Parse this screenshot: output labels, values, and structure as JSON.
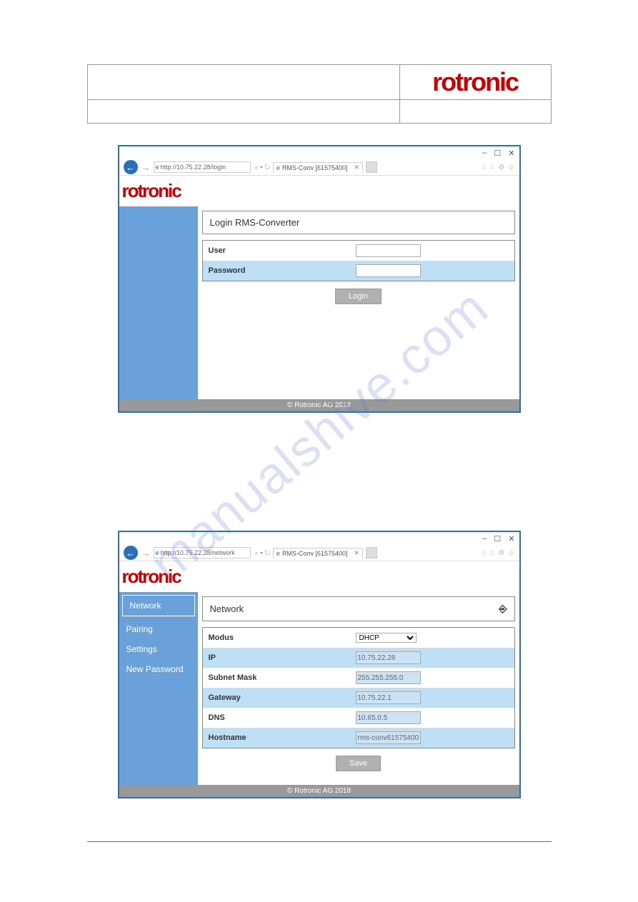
{
  "logo_text": "rotronic",
  "watermark": "manualshive.com",
  "screenshot1": {
    "win_controls": {
      "min": "–",
      "max": "☐",
      "close": "✕"
    },
    "url": "http://10.75.22.28/login",
    "search_icons": "⌕ ▾ ↻",
    "tab_label": "RMS-Conv [61575400]",
    "tab_close": "✕",
    "title_icons": {
      "home": "⌂",
      "star": "☆",
      "gear": "⚙",
      "smile": "☺"
    },
    "panel_title": "Login RMS-Converter",
    "rows": {
      "user": "User",
      "password": "Password"
    },
    "login_button": "Login",
    "footer": "© Rotronic AG 2018"
  },
  "screenshot2": {
    "win_controls": {
      "min": "–",
      "max": "☐",
      "close": "✕"
    },
    "url": "http://10.75.22.28/network",
    "search_icons": "⌕ ▾ ↻",
    "tab_label": "RMS-Conv [61575400]",
    "tab_close": "✕",
    "title_icons": {
      "home": "⌂",
      "star": "☆",
      "gear": "⚙",
      "smile": "☺"
    },
    "sidebar": [
      "Network",
      "Pairing",
      "Settings",
      "New Password"
    ],
    "panel_title": "Network",
    "logout_icon": "⎆",
    "rows": {
      "modus": {
        "label": "Modus",
        "value": "DHCP"
      },
      "ip": {
        "label": "IP",
        "value": "10.75.22.28"
      },
      "subnet": {
        "label": "Subnet Mask",
        "value": "255.255.255.0"
      },
      "gateway": {
        "label": "Gateway",
        "value": "10.75.22.1"
      },
      "dns": {
        "label": "DNS",
        "value": "10.65.0.5"
      },
      "hostname": {
        "label": "Hostname",
        "value": "rms-conv61575400"
      }
    },
    "save_button": "Save",
    "footer": "© Rotronic AG 2018"
  }
}
